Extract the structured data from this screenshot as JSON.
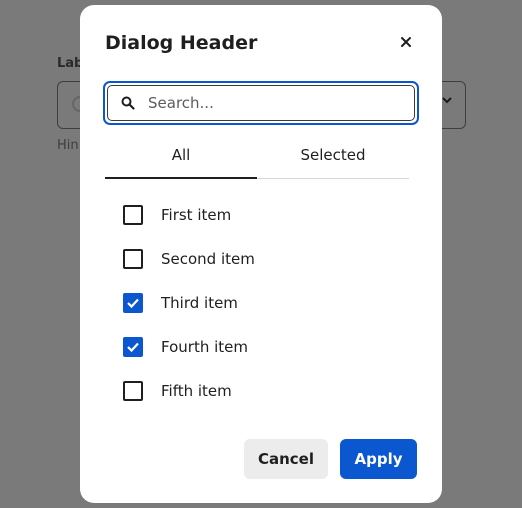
{
  "background": {
    "label": "Lab",
    "hint": "Hin"
  },
  "dialog": {
    "title": "Dialog Header",
    "close_icon": "close-icon",
    "search": {
      "placeholder": "Search...",
      "value": "",
      "icon": "search-icon"
    },
    "tabs": [
      {
        "label": "All",
        "active": true
      },
      {
        "label": "Selected",
        "active": false
      }
    ],
    "items": [
      {
        "label": "First item",
        "checked": false
      },
      {
        "label": "Second item",
        "checked": false
      },
      {
        "label": "Third item",
        "checked": true
      },
      {
        "label": "Fourth item",
        "checked": true
      },
      {
        "label": "Fifth item",
        "checked": false
      }
    ],
    "buttons": {
      "cancel": "Cancel",
      "apply": "Apply"
    }
  },
  "colors": {
    "accent": "#0b57d0",
    "overlay": "#7a7a7a"
  }
}
